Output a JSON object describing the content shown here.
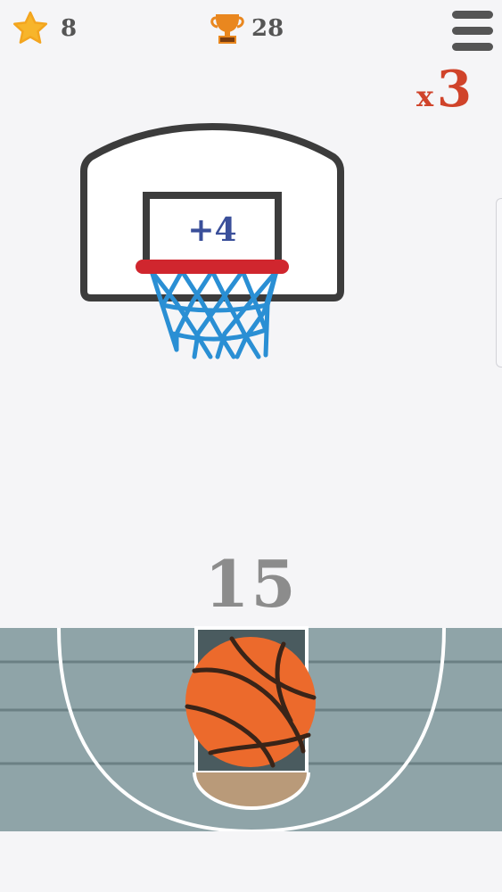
{
  "hud": {
    "stars": "8",
    "best_score": "28",
    "menu_icon": "hamburger-menu-icon",
    "star_icon": "star-icon",
    "trophy_icon": "trophy-icon"
  },
  "multiplier": {
    "prefix": "x",
    "value": "3"
  },
  "hoop": {
    "backboard_bonus": "+4",
    "rim_color": "#d0262e",
    "net_color": "#2a8fd4"
  },
  "game": {
    "score": "15"
  },
  "colors": {
    "background": "#f5f5f7",
    "court": "#8fa4a8",
    "ball": "#ec6a2c",
    "multiplier": "#d0432a",
    "star": "#f7b52b",
    "trophy": "#e9871f"
  }
}
